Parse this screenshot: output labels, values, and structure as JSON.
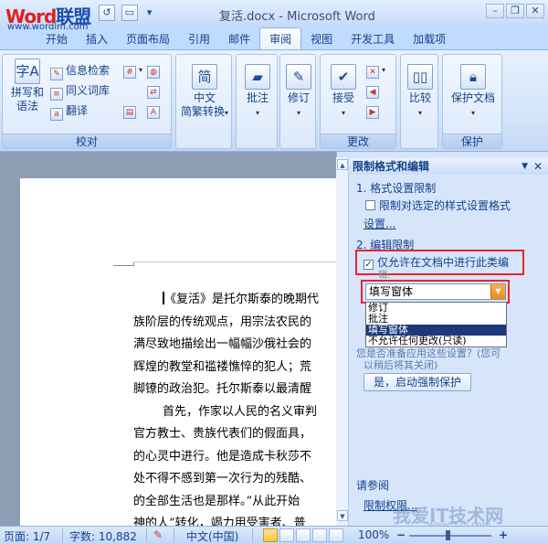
{
  "titlebar": {
    "logo_w": "Word",
    "logo_rest": "联盟",
    "logo_url": "www.wordlm.com",
    "window_title": "复活.docx - Microsoft Word",
    "win_min": "–",
    "win_max": "❐",
    "win_close": "✕"
  },
  "tabs": [
    "开始",
    "插入",
    "页面布局",
    "引用",
    "邮件",
    "审阅",
    "视图",
    "开发工具",
    "加载项"
  ],
  "active_tab": "审阅",
  "ribbon": {
    "proofing": {
      "label": "校对",
      "spelling_line1": "拼写和",
      "spelling_line2": "语法",
      "research": "信息检索",
      "thesaurus": "同义词库",
      "translate": "翻译"
    },
    "chinese": {
      "line1": "中文",
      "line2": "简繁转换"
    },
    "comment": {
      "label": "批注"
    },
    "tracking": {
      "label": "修订"
    },
    "changes": {
      "label": "更改",
      "accept": "接受"
    },
    "compare": {
      "label": "比较"
    },
    "protect": {
      "label": "保护",
      "protect_doc": "保护文档"
    }
  },
  "document": {
    "lines": [
      "《复活》是托尔斯泰的晚期代",
      "族阶层的传统观点，用宗法农民的",
      "满尽致地描绘出一幅幅沙俄社会的",
      "辉煌的教堂和褴褛憔悴的犯人；荒",
      "脚镣的政治犯。托尔斯泰以最清醒",
      "首先，作家以人民的名义审判",
      "官方教士、贵族代表们的假面具，",
      "的心灵中进行。他是造成卡秋莎不",
      "处不得不感到第一次行为的残酷、",
      "的全部生活也是那样。”从此开始",
      "神的人”转化，竭力用受害者、普"
    ]
  },
  "pane": {
    "title": "限制格式和编辑",
    "section1": "1. 格式设置限制",
    "format_checkbox": "限制对选定的样式设置格式",
    "settings_link": "设置...",
    "section2": "2. 编辑限制",
    "edit_checkbox": "仅允许在文档中进行此类编",
    "edit_checkbox_cont": "辑:",
    "edit_checked": true,
    "combo_value": "填写窗体",
    "options": [
      "修订",
      "批注",
      "填写窗体",
      "不允许任何更改(只读)"
    ],
    "selected_option": "填写窗体",
    "section3_partial": "您是否准备应用这些设置？(您可",
    "section3_partial2": "以稍后将其关闭)",
    "start_button": "是，启动强制保护",
    "see_also": "请参阅",
    "restrict_link": "限制权限..."
  },
  "watermark": {
    "text": "我爱IT技术网",
    "url": "www.52ij.com"
  },
  "statusbar": {
    "page": "页面: 1/7",
    "words": "字数: 10,882",
    "language": "中文(中国)",
    "zoom": "100%",
    "zoom_level": 1.0
  }
}
